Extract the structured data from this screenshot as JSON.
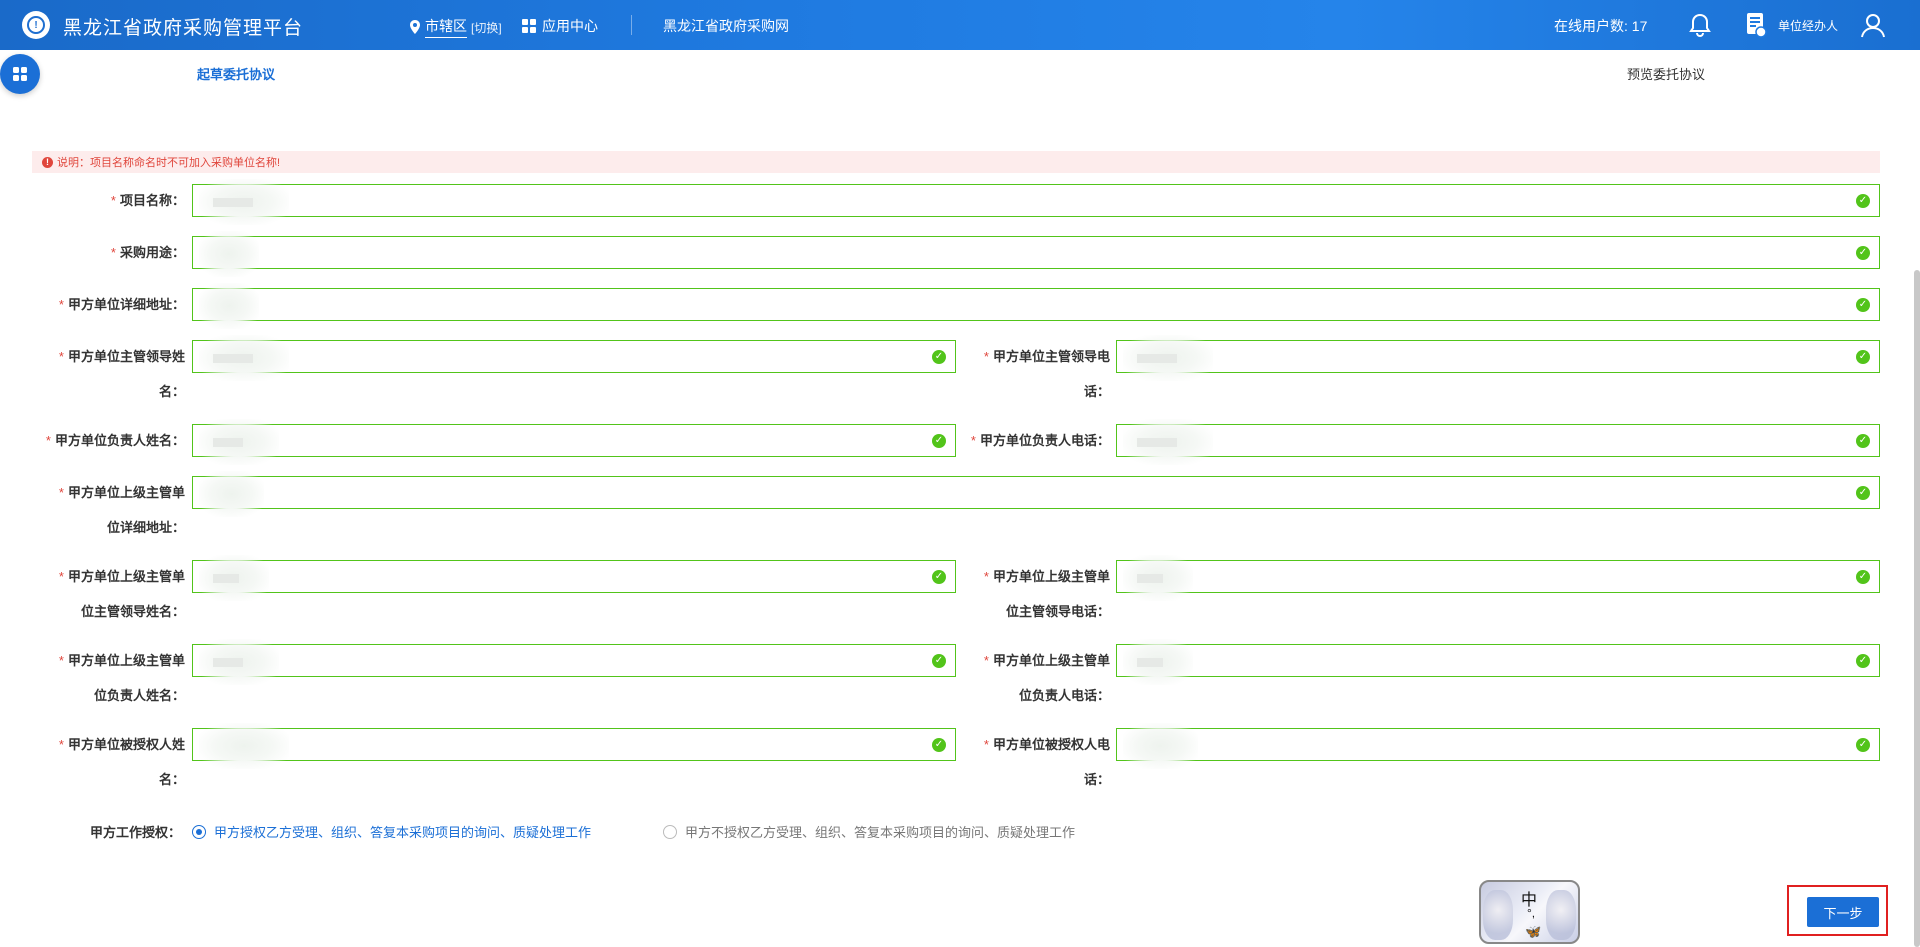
{
  "header": {
    "title": "黑龙江省政府采购管理平台",
    "region": "市辖区",
    "switch": "[切换]",
    "app_center": "应用中心",
    "portal_link": "黑龙江省政府采购网",
    "online_users": "在线用户数: 17",
    "user_role": "单位经办人"
  },
  "steps": {
    "current": "起草委托协议",
    "next": "预览委托协议"
  },
  "notice": "说明：项目名称命名时不可加入采购单位名称!",
  "form": {
    "project_name": "项目名称：",
    "purpose": "采购用途：",
    "address": "甲方单位详细地址：",
    "leader_name_a": "甲方单位主管领导姓",
    "leader_name_b": "名：",
    "leader_phone_a": "甲方单位主管领导电",
    "leader_phone_b": "话：",
    "responsible_name": "甲方单位负责人姓名：",
    "responsible_phone": "甲方单位负责人电话：",
    "super_addr_a": "甲方单位上级主管单",
    "super_addr_b": "位详细地址：",
    "super_leader_name_a": "甲方单位上级主管单",
    "super_leader_name_b": "位主管领导姓名：",
    "super_leader_phone_a": "甲方单位上级主管单",
    "super_leader_phone_b": "位主管领导电话：",
    "super_resp_name_a": "甲方单位上级主管单",
    "super_resp_name_b": "位负责人姓名：",
    "super_resp_phone_a": "甲方单位上级主管单",
    "super_resp_phone_b": "位负责人电话：",
    "auth_name_a": "甲方单位被授权人姓",
    "auth_name_b": "名：",
    "auth_phone_a": "甲方单位被授权人电",
    "auth_phone_b": "话："
  },
  "authorization": {
    "label": "甲方工作授权：",
    "option_yes": "甲方授权乙方受理、组织、答复本采购项目的询问、质疑处理工作",
    "option_no": "甲方不授权乙方受理、组织、答复本采购项目的询问、质疑处理工作",
    "selected": "option_yes"
  },
  "ime": {
    "mode": "中",
    "punct": "°,"
  },
  "buttons": {
    "next": "下一步"
  }
}
